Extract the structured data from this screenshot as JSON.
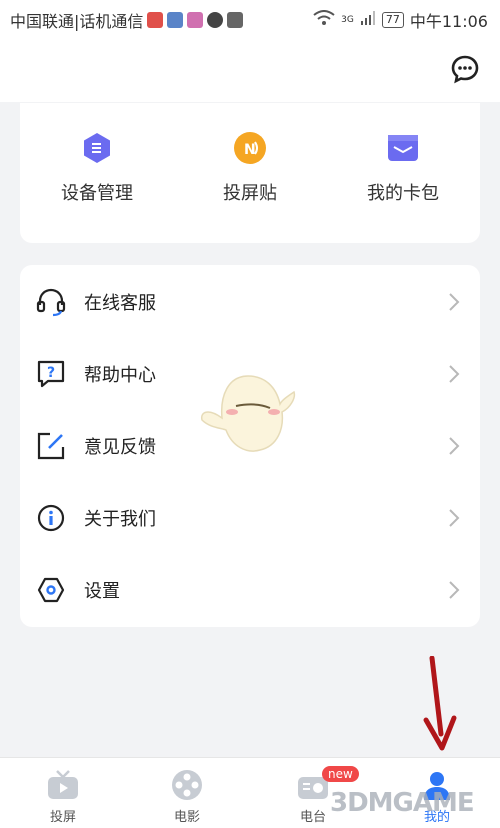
{
  "status_bar": {
    "carrier": "中国联通|话机通信",
    "network": "3G",
    "battery": "77",
    "time": "中午11:06"
  },
  "quick_actions": [
    {
      "label": "设备管理",
      "icon": "device-management-icon"
    },
    {
      "label": "投屏贴",
      "icon": "nfc-sticker-icon"
    },
    {
      "label": "我的卡包",
      "icon": "card-wallet-icon"
    }
  ],
  "menu": [
    {
      "label": "在线客服",
      "icon": "headset-icon"
    },
    {
      "label": "帮助中心",
      "icon": "help-icon"
    },
    {
      "label": "意见反馈",
      "icon": "feedback-icon"
    },
    {
      "label": "关于我们",
      "icon": "info-icon"
    },
    {
      "label": "设置",
      "icon": "settings-icon"
    }
  ],
  "tabs": [
    {
      "label": "投屏",
      "icon": "tv-icon"
    },
    {
      "label": "电影",
      "icon": "film-reel-icon"
    },
    {
      "label": "电台",
      "icon": "radio-icon",
      "badge": "new"
    },
    {
      "label": "我的",
      "icon": "profile-icon",
      "active": true
    }
  ],
  "watermark": "3DMGAME",
  "colors": {
    "accent_blue": "#2d76f5",
    "purple": "#6b6bf0",
    "orange": "#f5a623",
    "badge_red": "#f04848",
    "annotation_arrow": "#b0161a"
  }
}
